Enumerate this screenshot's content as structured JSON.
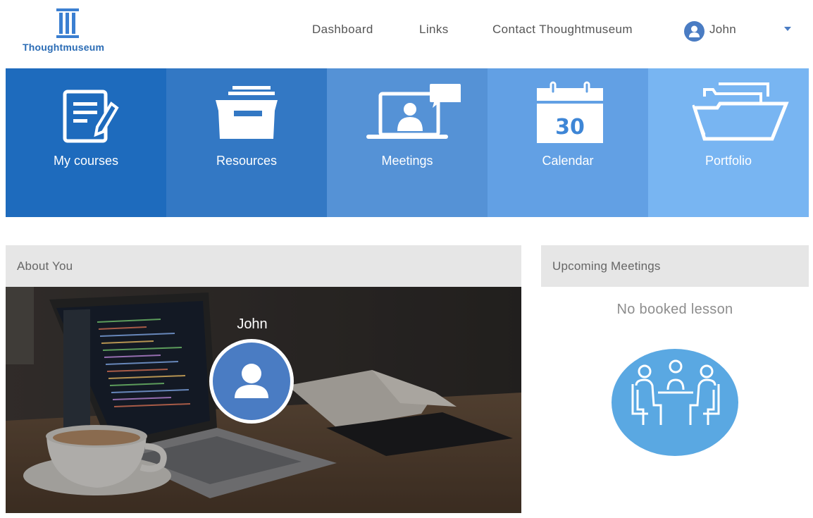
{
  "brand": {
    "name": "Thoughtmuseum",
    "logo_icon": "pillar-icon",
    "color": "#2b6cb5"
  },
  "nav": {
    "dashboard": "Dashboard",
    "links": "Links",
    "contact": "Contact Thoughtmuseum"
  },
  "user": {
    "name": "John",
    "avatar_icon": "user-avatar-icon"
  },
  "tiles": [
    {
      "label": "My courses",
      "icon": "edit-document-icon",
      "color": "#1e6bbd"
    },
    {
      "label": "Resources",
      "icon": "file-drawer-icon",
      "color": "#3378c4"
    },
    {
      "label": "Meetings",
      "icon": "video-meeting-icon",
      "color": "#5592d6"
    },
    {
      "label": "Calendar",
      "icon": "calendar-icon",
      "color": "#62a0e4",
      "calendar_day": "30"
    },
    {
      "label": "Portfolio",
      "icon": "folder-icon",
      "color": "#78b5f2"
    }
  ],
  "about": {
    "title": "About You",
    "name": "John"
  },
  "upcoming": {
    "title": "Upcoming Meetings",
    "empty_text": "No booked lesson",
    "icon": "meeting-table-icon"
  }
}
